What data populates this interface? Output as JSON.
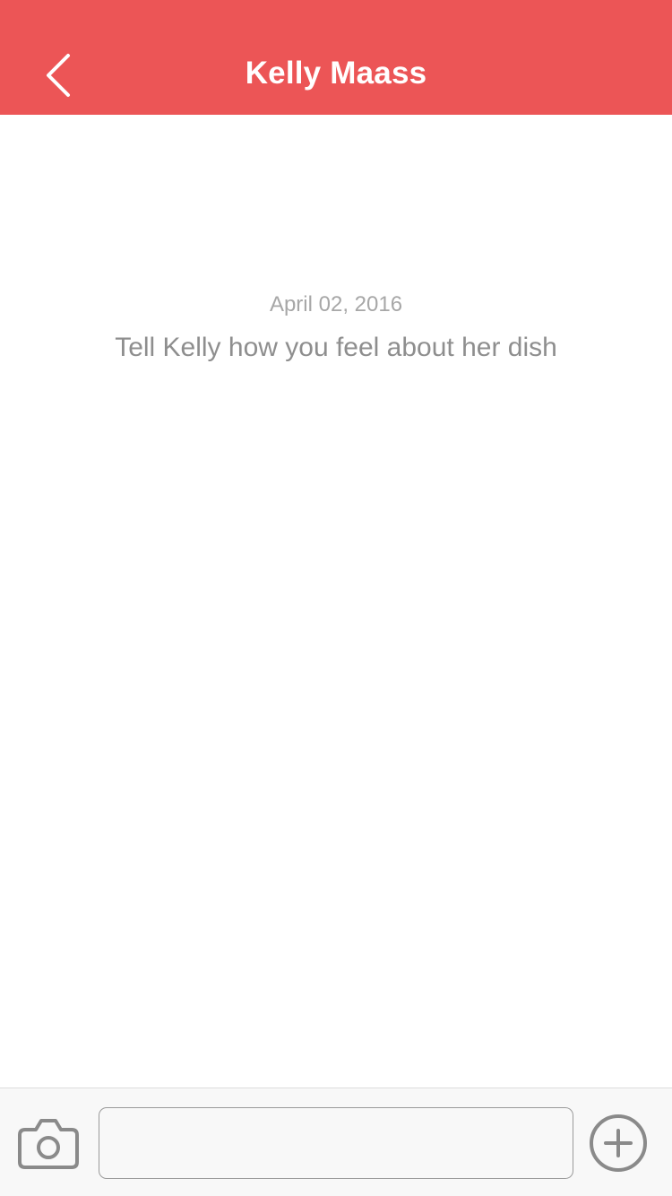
{
  "header": {
    "title": "Kelly Maass",
    "back_icon": "chevron-left-icon"
  },
  "conversation": {
    "date": "April 02, 2016",
    "prompt": "Tell Kelly how you feel about her dish"
  },
  "composer": {
    "camera_icon": "camera-icon",
    "input_value": "",
    "input_placeholder": "",
    "add_icon": "plus-circle-icon"
  },
  "colors": {
    "header_background": "#ec5556",
    "header_text": "#ffffff",
    "date_text": "#a7a7a7",
    "prompt_text": "#8e8e8e",
    "composer_background": "#f8f8f8",
    "icon_gray": "#8a8a8a"
  }
}
